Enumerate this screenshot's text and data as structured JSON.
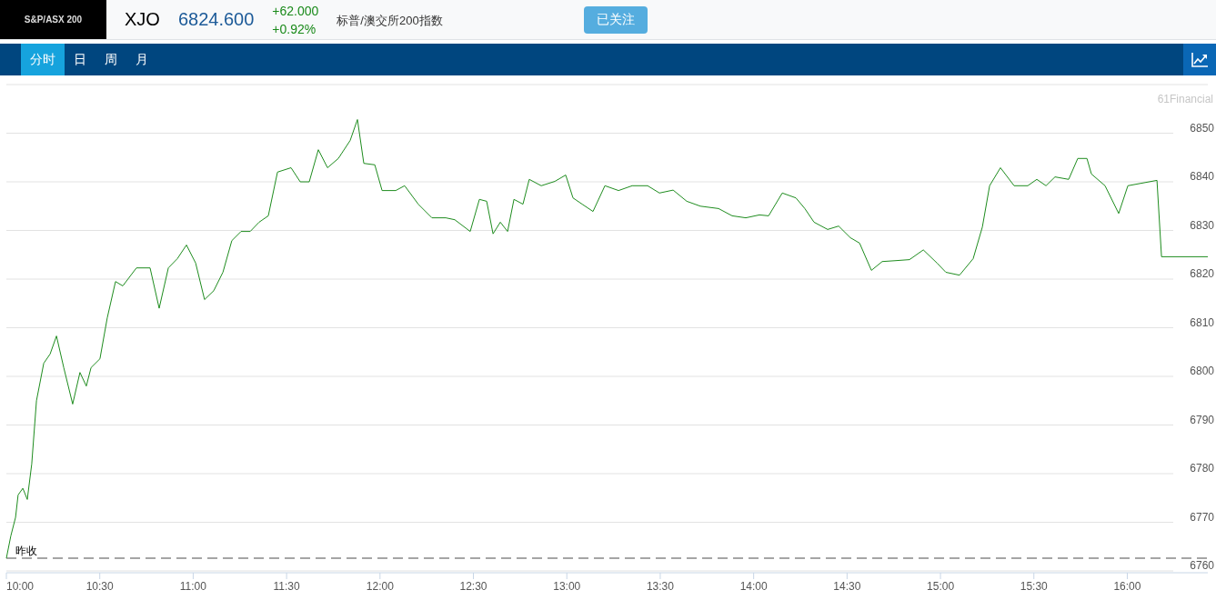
{
  "header": {
    "logo": "S&P/ASX 200",
    "symbol": "XJO",
    "price": "6824.600",
    "change": "+62.000",
    "change_percent": "+0.92%",
    "name": "标普/澳交所200指数",
    "follow_button": "已关注"
  },
  "tabs": [
    {
      "label": "分时",
      "selected": true
    },
    {
      "label": "日",
      "selected": false
    },
    {
      "label": "周",
      "selected": false
    },
    {
      "label": "月",
      "selected": false
    }
  ],
  "chart": {
    "source": "61Financial",
    "chart_data": {
      "type": "line",
      "x": [
        10,
        10.024,
        10.049,
        10.063,
        10.088,
        10.112,
        10.136,
        10.161,
        10.2,
        10.234,
        10.268,
        10.307,
        10.355,
        10.394,
        10.428,
        10.453,
        10.501,
        10.54,
        10.584,
        10.623,
        10.696,
        10.769,
        10.818,
        10.867,
        10.915,
        10.964,
        11.013,
        11.061,
        11.11,
        11.159,
        11.207,
        11.256,
        11.305,
        11.353,
        11.402,
        11.451,
        11.524,
        11.573,
        11.621,
        11.67,
        11.719,
        11.777,
        11.84,
        11.879,
        11.913,
        11.972,
        12.011,
        12.084,
        12.132,
        12.205,
        12.278,
        12.352,
        12.4,
        12.483,
        12.532,
        12.571,
        12.605,
        12.644,
        12.683,
        12.717,
        12.765,
        12.799,
        12.863,
        12.936,
        12.994,
        13.033,
        13.082,
        13.14,
        13.204,
        13.277,
        13.35,
        13.432,
        13.496,
        13.569,
        13.642,
        13.715,
        13.812,
        13.885,
        13.958,
        14.031,
        14.08,
        14.153,
        14.226,
        14.274,
        14.323,
        14.396,
        14.455,
        14.518,
        14.567,
        14.63,
        14.688,
        14.761,
        14.834,
        14.908,
        14.981,
        15.029,
        15.102,
        15.175,
        15.224,
        15.263,
        15.321,
        15.394,
        15.467,
        15.516,
        15.565,
        15.613,
        15.686,
        15.735,
        15.784,
        15.808,
        15.881,
        15.954,
        16.003,
        16.159,
        16.183,
        16.431
      ],
      "series": [
        {
          "color": "#1e8c1e",
          "values": [
            6762.6,
            6767.2,
            6771,
            6775.6,
            6777,
            6774.7,
            6782,
            6795,
            6802.7,
            6804.6,
            6808.3,
            6801.8,
            6794.3,
            6800.8,
            6798,
            6801.8,
            6803.6,
            6812,
            6819.5,
            6818.6,
            6822.3,
            6822.3,
            6814,
            6822.3,
            6824.2,
            6827,
            6823.3,
            6815.8,
            6817.6,
            6821.4,
            6827.9,
            6829.8,
            6829.8,
            6831.7,
            6833,
            6842,
            6842.9,
            6840,
            6840,
            6846.6,
            6842.9,
            6844.8,
            6848.5,
            6852.8,
            6843.8,
            6843.5,
            6838.2,
            6838.2,
            6839.2,
            6835.4,
            6832.6,
            6832.6,
            6832.2,
            6829.8,
            6836.4,
            6836,
            6829.3,
            6831.7,
            6829.8,
            6836.4,
            6835.4,
            6840.5,
            6839.2,
            6840.1,
            6841.4,
            6836.7,
            6835.4,
            6833.9,
            6839.2,
            6838.2,
            6839.2,
            6839.2,
            6837.7,
            6838.3,
            6836,
            6835,
            6834.5,
            6833,
            6832.6,
            6833.2,
            6833,
            6837.7,
            6836.7,
            6834.5,
            6831.7,
            6830.2,
            6830.9,
            6828.5,
            6827.4,
            6821.8,
            6823.6,
            6823.8,
            6824,
            6826,
            6823.3,
            6821.4,
            6820.8,
            6824.2,
            6830.7,
            6839.2,
            6842.9,
            6839.2,
            6839.2,
            6840.5,
            6839.2,
            6841,
            6840.5,
            6844.8,
            6844.8,
            6841.6,
            6839.2,
            6833.5,
            6839.2,
            6840.3,
            6824.6,
            6824.6
          ]
        }
      ],
      "xlim": [
        10,
        16.431
      ],
      "ylim": [
        6760,
        6860
      ],
      "xticks": [
        {
          "value": 10,
          "label": "10:00"
        },
        {
          "value": 10.5,
          "label": "10:30"
        },
        {
          "value": 11,
          "label": "11:00"
        },
        {
          "value": 11.5,
          "label": "11:30"
        },
        {
          "value": 12,
          "label": "12:00"
        },
        {
          "value": 12.5,
          "label": "12:30"
        },
        {
          "value": 13,
          "label": "13:00"
        },
        {
          "value": 13.5,
          "label": "13:30"
        },
        {
          "value": 14,
          "label": "14:00"
        },
        {
          "value": 14.5,
          "label": "14:30"
        },
        {
          "value": 15,
          "label": "15:00"
        },
        {
          "value": 15.5,
          "label": "15:30"
        },
        {
          "value": 16,
          "label": "16:00"
        }
      ],
      "yticks": [
        6850,
        6840,
        6830,
        6820,
        6810,
        6800,
        6790,
        6780,
        6770,
        6760
      ],
      "grid": true,
      "ref_lines": [
        {
          "axis": "y",
          "value": 6762.6,
          "label": "昨收"
        }
      ]
    }
  }
}
